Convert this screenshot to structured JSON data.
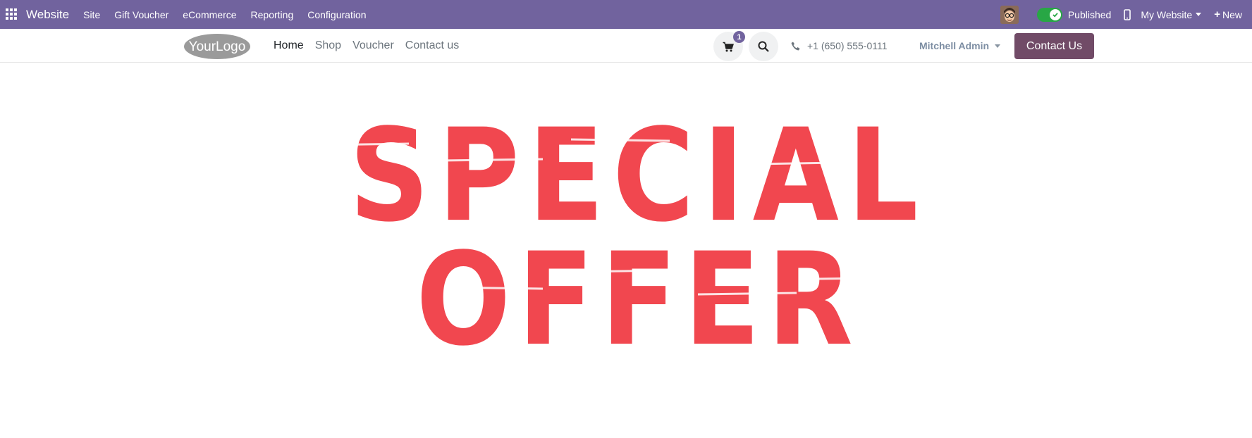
{
  "adminbar": {
    "app_name": "Website",
    "menu": [
      "Site",
      "Gift Voucher",
      "eCommerce",
      "Reporting",
      "Configuration"
    ],
    "published_label": "Published",
    "website_selector": "My Website",
    "new_label": "New"
  },
  "header": {
    "logo_text": "YourLogo",
    "nav": [
      "Home",
      "Shop",
      "Voucher",
      "Contact us"
    ],
    "cart_count": "1",
    "phone": "+1 (650) 555-0111",
    "user": "Mitchell Admin",
    "cta": "Contact Us"
  },
  "hero": {
    "line1": "SPECIAL",
    "line2": "OFFER"
  },
  "colors": {
    "adminbar_bg": "#71639e",
    "cta_bg": "#714b67",
    "hero_text": "#f1474f",
    "toggle_on": "#28a745"
  }
}
